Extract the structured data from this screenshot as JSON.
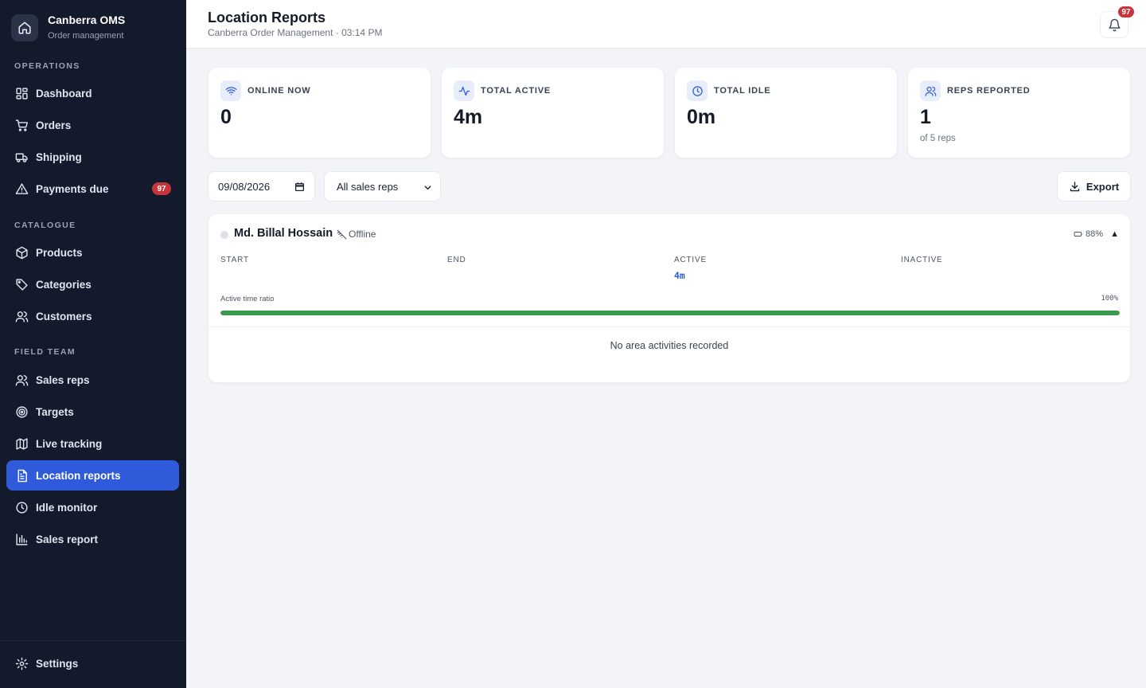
{
  "brand": {
    "name": "Canberra OMS",
    "subtitle": "Order management"
  },
  "sidebar": {
    "sections": [
      {
        "title": "OPERATIONS"
      },
      {
        "title": "CATALOGUE"
      },
      {
        "title": "FIELD TEAM"
      }
    ],
    "items": [
      {
        "label": "Dashboard",
        "icon": "grid-icon"
      },
      {
        "label": "Orders",
        "icon": "cart-icon"
      },
      {
        "label": "Shipping",
        "icon": "truck-icon"
      },
      {
        "label": "Payments due",
        "icon": "warning-icon",
        "badge": "97"
      },
      {
        "label": "Products",
        "icon": "box-icon"
      },
      {
        "label": "Categories",
        "icon": "tag-icon"
      },
      {
        "label": "Customers",
        "icon": "users-icon"
      },
      {
        "label": "Sales reps",
        "icon": "users-icon"
      },
      {
        "label": "Targets",
        "icon": "target-icon"
      },
      {
        "label": "Live tracking",
        "icon": "map-icon"
      },
      {
        "label": "Location reports",
        "icon": "file-text-icon",
        "active": true
      },
      {
        "label": "Idle monitor",
        "icon": "clock-icon"
      },
      {
        "label": "Sales report",
        "icon": "bar-chart-icon"
      }
    ],
    "settings_label": "Settings"
  },
  "header": {
    "title": "Location Reports",
    "subtitle": "Canberra Order Management · 03:14 PM",
    "notification_count": "97"
  },
  "stats": [
    {
      "label": "ONLINE NOW",
      "value": "0",
      "icon": "wifi-icon"
    },
    {
      "label": "TOTAL ACTIVE",
      "value": "4m",
      "icon": "activity-icon"
    },
    {
      "label": "TOTAL IDLE",
      "value": "0m",
      "icon": "clock-icon"
    },
    {
      "label": "REPS REPORTED",
      "value": "1",
      "note": "of 5 reps",
      "icon": "users-icon"
    }
  ],
  "filters": {
    "date": "09/08/2026",
    "rep_select": "All sales reps",
    "export_label": "Export"
  },
  "report": {
    "rep_name": "Md. Billal Hossain",
    "status": "Offline",
    "battery": "88%",
    "collapse_glyph": "▲",
    "columns": [
      {
        "label": "START",
        "value": ""
      },
      {
        "label": "END",
        "value": ""
      },
      {
        "label": "ACTIVE",
        "value": "4m"
      },
      {
        "label": "INACTIVE",
        "value": ""
      }
    ],
    "ratio_label": "Active time ratio",
    "ratio_text": "100%",
    "ratio_fraction": 1.0,
    "ratio_color": "#3c9a4f",
    "empty_message": "No area activities recorded"
  },
  "colors": {
    "accent": "#2f5bdb",
    "sidebar_bg": "#121a2b",
    "badge": "#c8343b"
  }
}
